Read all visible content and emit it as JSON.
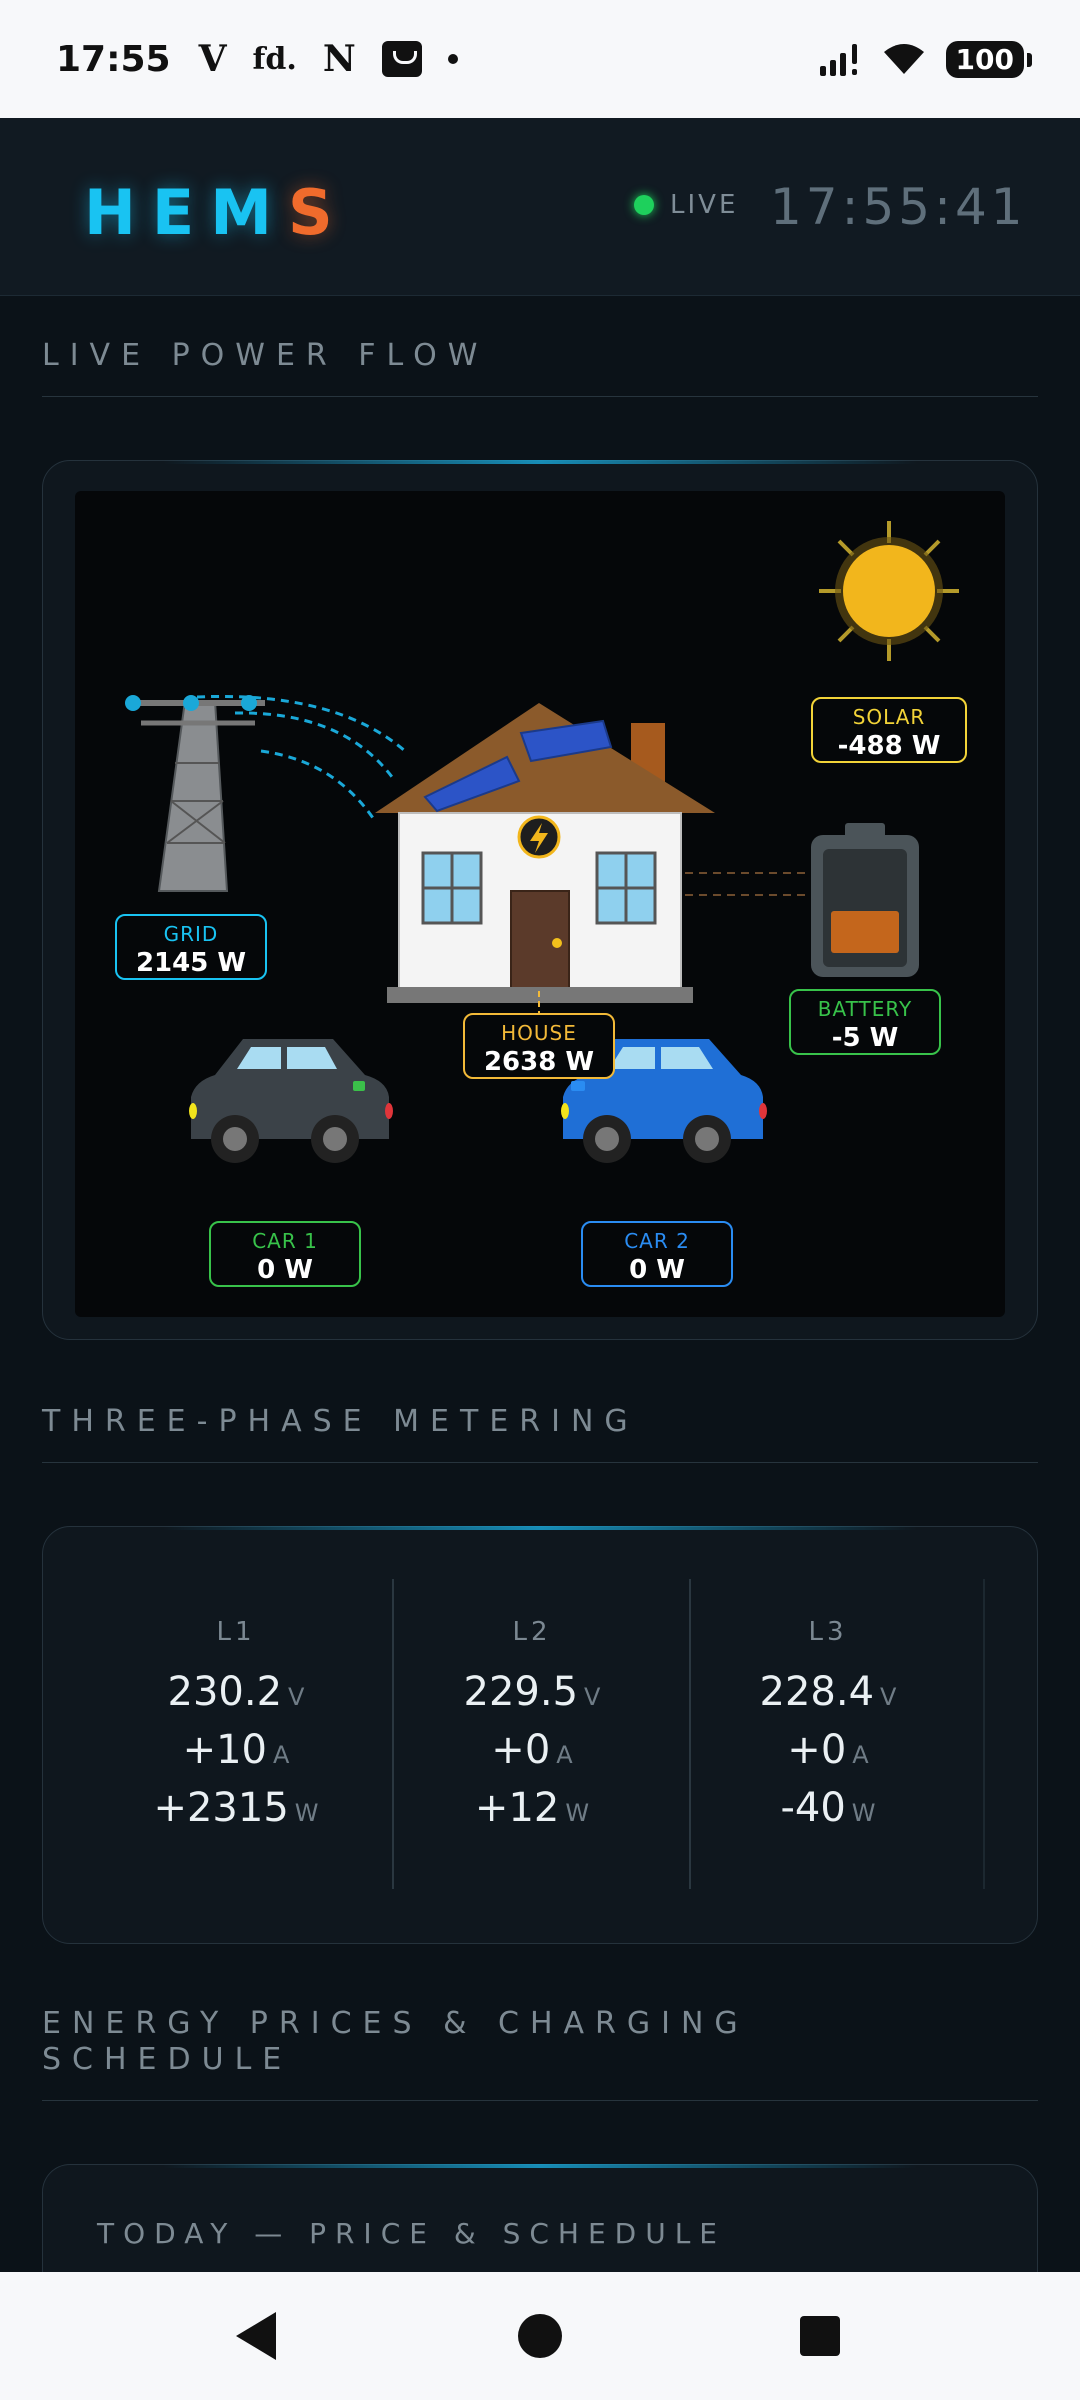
{
  "status_bar": {
    "time": "17:55",
    "apps": [
      "V",
      "fd.",
      "N"
    ],
    "battery": "100"
  },
  "header": {
    "logo_main": "HEM",
    "logo_accent": "S",
    "live_label": "LIVE",
    "clock": "17:55:41"
  },
  "sections": {
    "power_flow": "LIVE POWER FLOW",
    "metering": "THREE-PHASE METERING",
    "prices_line1": "ENERGY PRICES & CHARGING",
    "prices_line2": "SCHEDULE"
  },
  "flow": {
    "grid": {
      "label": "GRID",
      "value": "2145 W",
      "color": "#19c3f2"
    },
    "solar": {
      "label": "SOLAR",
      "value": "-488 W",
      "color": "#f2d338"
    },
    "house": {
      "label": "HOUSE",
      "value": "2638 W",
      "color": "#f2b938"
    },
    "battery": {
      "label": "BATTERY",
      "value": "-5 W",
      "color": "#38c24a"
    },
    "car1": {
      "label": "CAR 1",
      "value": "0 W",
      "color": "#38c24a"
    },
    "car2": {
      "label": "CAR 2",
      "value": "0 W",
      "color": "#2a8cf2"
    }
  },
  "metering": {
    "phases": [
      {
        "name": "L1",
        "voltage": "230.2",
        "current": "+10",
        "power": "+2315"
      },
      {
        "name": "L2",
        "voltage": "229.5",
        "current": "+0",
        "power": "+12"
      },
      {
        "name": "L3",
        "voltage": "228.4",
        "current": "+0",
        "power": "-40"
      }
    ],
    "units": {
      "voltage": "V",
      "current": "A",
      "power": "W"
    }
  },
  "prices": {
    "subtitle": "TODAY — PRICE & SCHEDULE"
  }
}
